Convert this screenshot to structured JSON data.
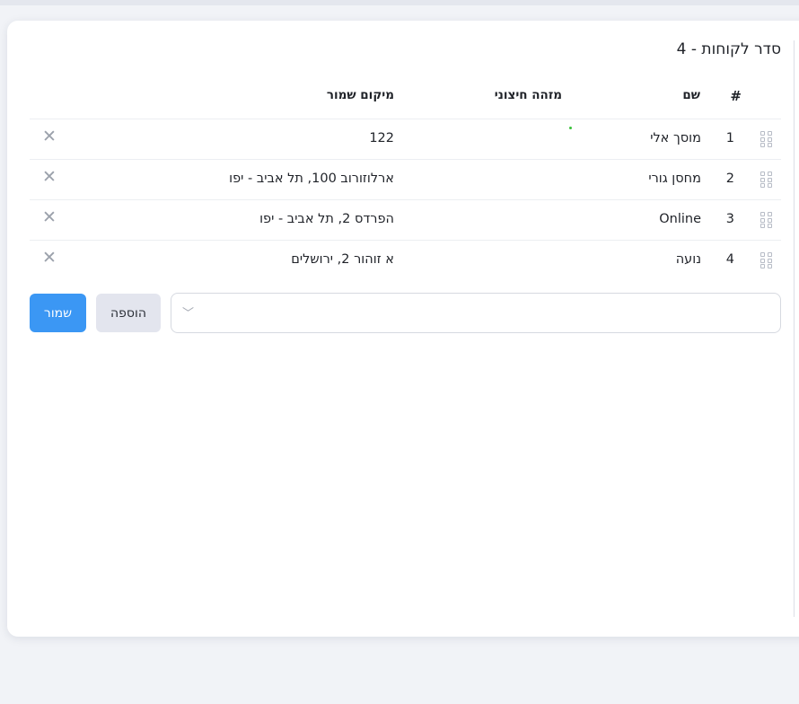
{
  "page": {
    "title": "סדר לקוחות - 4"
  },
  "table": {
    "headers": {
      "index": "#",
      "name": "שם",
      "external_id": "מזהה חיצוני",
      "saved_location": "מיקום שמור"
    },
    "rows": [
      {
        "index": "1",
        "name": "מוסך אלי",
        "external_id": "",
        "saved_location": "122"
      },
      {
        "index": "2",
        "name": "מחסן גורי",
        "external_id": "",
        "saved_location": "ארלוזורוב 100, תל אביב - יפו"
      },
      {
        "index": "3",
        "name": "Online",
        "external_id": "",
        "saved_location": "הפרדס 2, תל אביב - יפו"
      },
      {
        "index": "4",
        "name": "נועה",
        "external_id": "",
        "saved_location": "א זוהור 2, ירושלים"
      }
    ]
  },
  "controls": {
    "select_value": "",
    "add_label": "הוספה",
    "save_label": "שמור"
  },
  "icons": {
    "drag": "drag-handle-icon",
    "delete": "close-icon",
    "chevron": "chevron-down-icon"
  },
  "colors": {
    "primary": "#3b97f4",
    "secondary_button": "#e3e5ee",
    "page_background": "#f1f3f7"
  }
}
